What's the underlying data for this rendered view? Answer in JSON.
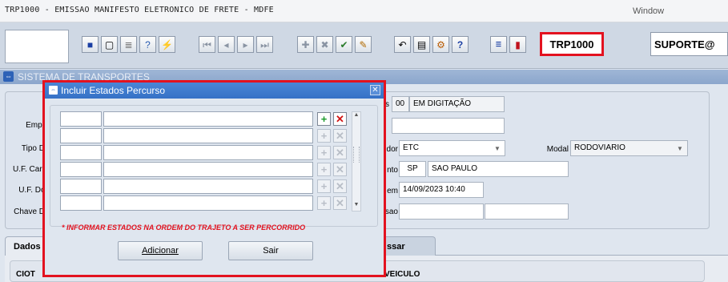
{
  "window": {
    "title": "TRP1000 - EMISSAO MANIFESTO ELETRONICO DE FRETE - MDFE",
    "menu_window": "Window"
  },
  "toolbar": {
    "screen_code": "TRP1000",
    "user": "SUPORTE@",
    "buttons": [
      "save",
      "print",
      "preview",
      "help-query",
      "execute-query",
      "first",
      "previous",
      "next",
      "last",
      "insert",
      "delete",
      "search",
      "edit",
      "undo",
      "copy",
      "tools",
      "help",
      "menu",
      "exit"
    ]
  },
  "system": {
    "title": "SISTEMA DE TRANSPORTES"
  },
  "form": {
    "labels": {
      "empresa": "Empr",
      "tipo": "Tipo D",
      "uf_carr": "U.F. Carr",
      "uf_desc": "U.F. Dc",
      "chave": "Chave D",
      "modal": "Modal",
      "status_suffix": "s",
      "emissor_suffix": "dor",
      "carreg_suffix": "nto",
      "emissao_suffix": "em",
      "encerramento_suffix": "sao"
    },
    "status_code": "00",
    "status_text": "EM DIGITAÇÃO",
    "emissor": "ETC",
    "modal": "RODOVIARIO",
    "uf_code": "SP",
    "uf_name": "SAO PAULO",
    "emissao_datetime": "14/09/2023 10:40"
  },
  "tabs": [
    {
      "label": "Dados"
    },
    {
      "label": "ssar"
    }
  ],
  "tab_content": {
    "ciot_label": "CIOT",
    "vehicle_label": "VEICULO"
  },
  "modal": {
    "title": "Incluir Estados Percurso",
    "row_count": 6,
    "hint": "* INFORMAR ESTADOS NA ORDEM DO TRAJETO A SER PERCORRIDO",
    "add_button": "Adicionar",
    "exit_button": "Sair"
  },
  "colors": {
    "highlight_red": "#e3121f",
    "modal_title_blue": "#3571c6",
    "add_green": "#1a9a2a"
  }
}
